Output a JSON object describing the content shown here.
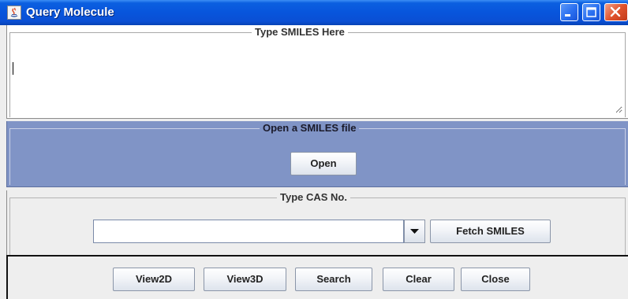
{
  "window": {
    "title": "Query Molecule",
    "controls": [
      "minimize-icon",
      "maximize-icon",
      "close-icon"
    ]
  },
  "smiles_section": {
    "legend": "Type SMILES Here",
    "value": ""
  },
  "open_section": {
    "legend": "Open a SMILES file",
    "open_label": "Open"
  },
  "cas_section": {
    "legend": "Type CAS No.",
    "input_value": "",
    "fetch_label": "Fetch SMILES"
  },
  "actions": {
    "view2d": "View2D",
    "view3d": "View3D",
    "search": "Search",
    "clear": "Clear",
    "close": "Close"
  },
  "colors": {
    "titlebar": "#0855dc",
    "open_panel": "#8094c6",
    "close_button": "#e0542e"
  }
}
